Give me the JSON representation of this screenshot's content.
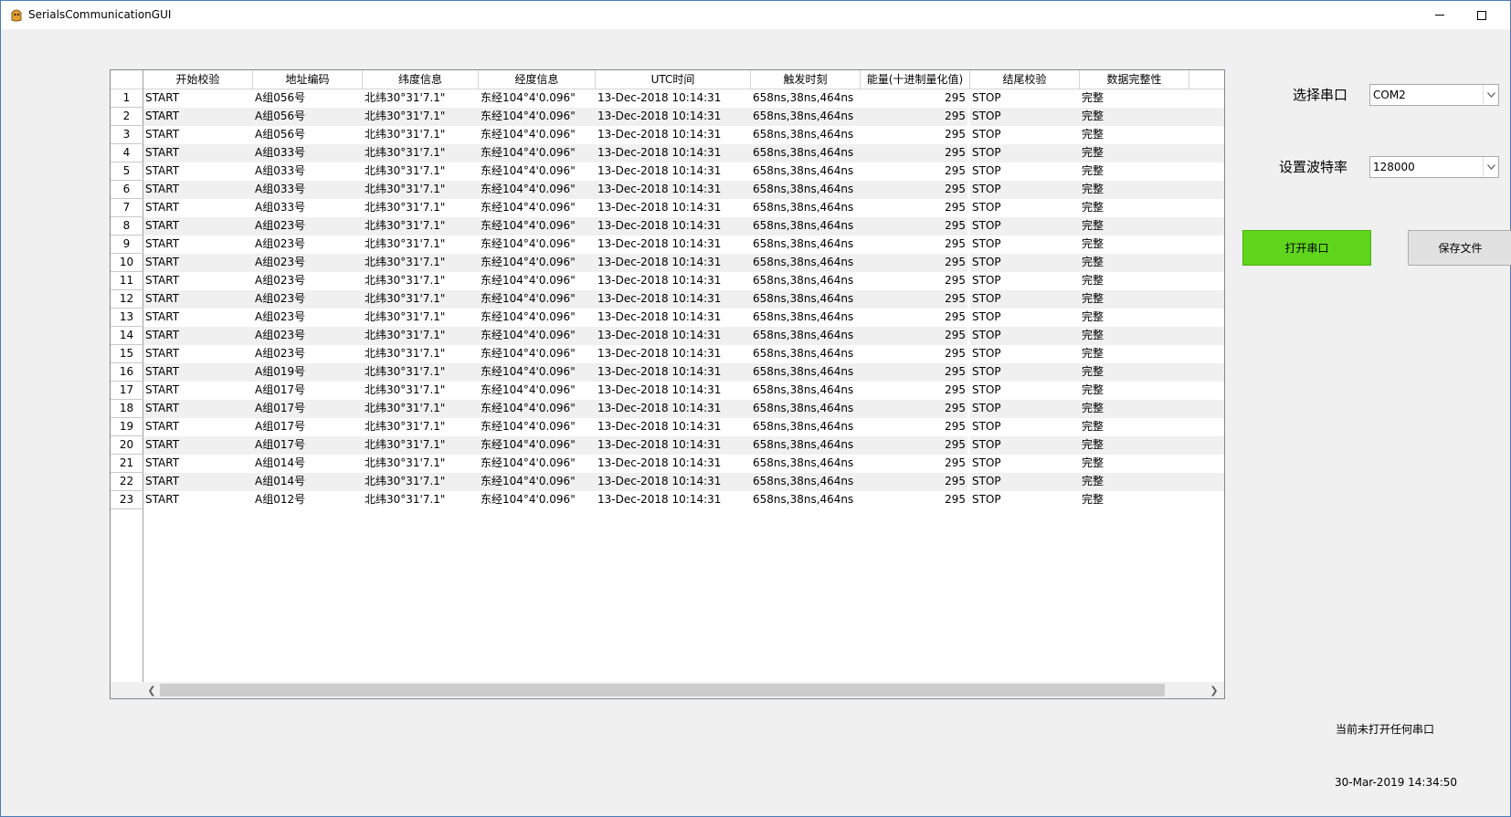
{
  "window": {
    "title": "SerialsCommunicationGUI"
  },
  "table": {
    "columns": [
      "开始校验",
      "地址编码",
      "纬度信息",
      "经度信息",
      "UTC时间",
      "触发时刻",
      "能量(十进制量化值)",
      "结尾校验",
      "数据完整性"
    ],
    "rows": [
      {
        "n": "1",
        "start": "START",
        "addr": "A组056号",
        "lat": "北纬30°31'7.1\"",
        "lon": "东经104°4'0.096\"",
        "utc": "13-Dec-2018 10:14:31",
        "trig": "658ns,38ns,464ns",
        "energy": "295",
        "end": "STOP",
        "integrity": "完整"
      },
      {
        "n": "2",
        "start": "START",
        "addr": "A组056号",
        "lat": "北纬30°31'7.1\"",
        "lon": "东经104°4'0.096\"",
        "utc": "13-Dec-2018 10:14:31",
        "trig": "658ns,38ns,464ns",
        "energy": "295",
        "end": "STOP",
        "integrity": "完整"
      },
      {
        "n": "3",
        "start": "START",
        "addr": "A组056号",
        "lat": "北纬30°31'7.1\"",
        "lon": "东经104°4'0.096\"",
        "utc": "13-Dec-2018 10:14:31",
        "trig": "658ns,38ns,464ns",
        "energy": "295",
        "end": "STOP",
        "integrity": "完整"
      },
      {
        "n": "4",
        "start": "START",
        "addr": "A组033号",
        "lat": "北纬30°31'7.1\"",
        "lon": "东经104°4'0.096\"",
        "utc": "13-Dec-2018 10:14:31",
        "trig": "658ns,38ns,464ns",
        "energy": "295",
        "end": "STOP",
        "integrity": "完整"
      },
      {
        "n": "5",
        "start": "START",
        "addr": "A组033号",
        "lat": "北纬30°31'7.1\"",
        "lon": "东经104°4'0.096\"",
        "utc": "13-Dec-2018 10:14:31",
        "trig": "658ns,38ns,464ns",
        "energy": "295",
        "end": "STOP",
        "integrity": "完整"
      },
      {
        "n": "6",
        "start": "START",
        "addr": "A组033号",
        "lat": "北纬30°31'7.1\"",
        "lon": "东经104°4'0.096\"",
        "utc": "13-Dec-2018 10:14:31",
        "trig": "658ns,38ns,464ns",
        "energy": "295",
        "end": "STOP",
        "integrity": "完整"
      },
      {
        "n": "7",
        "start": "START",
        "addr": "A组033号",
        "lat": "北纬30°31'7.1\"",
        "lon": "东经104°4'0.096\"",
        "utc": "13-Dec-2018 10:14:31",
        "trig": "658ns,38ns,464ns",
        "energy": "295",
        "end": "STOP",
        "integrity": "完整"
      },
      {
        "n": "8",
        "start": "START",
        "addr": "A组023号",
        "lat": "北纬30°31'7.1\"",
        "lon": "东经104°4'0.096\"",
        "utc": "13-Dec-2018 10:14:31",
        "trig": "658ns,38ns,464ns",
        "energy": "295",
        "end": "STOP",
        "integrity": "完整"
      },
      {
        "n": "9",
        "start": "START",
        "addr": "A组023号",
        "lat": "北纬30°31'7.1\"",
        "lon": "东经104°4'0.096\"",
        "utc": "13-Dec-2018 10:14:31",
        "trig": "658ns,38ns,464ns",
        "energy": "295",
        "end": "STOP",
        "integrity": "完整"
      },
      {
        "n": "10",
        "start": "START",
        "addr": "A组023号",
        "lat": "北纬30°31'7.1\"",
        "lon": "东经104°4'0.096\"",
        "utc": "13-Dec-2018 10:14:31",
        "trig": "658ns,38ns,464ns",
        "energy": "295",
        "end": "STOP",
        "integrity": "完整"
      },
      {
        "n": "11",
        "start": "START",
        "addr": "A组023号",
        "lat": "北纬30°31'7.1\"",
        "lon": "东经104°4'0.096\"",
        "utc": "13-Dec-2018 10:14:31",
        "trig": "658ns,38ns,464ns",
        "energy": "295",
        "end": "STOP",
        "integrity": "完整"
      },
      {
        "n": "12",
        "start": "START",
        "addr": "A组023号",
        "lat": "北纬30°31'7.1\"",
        "lon": "东经104°4'0.096\"",
        "utc": "13-Dec-2018 10:14:31",
        "trig": "658ns,38ns,464ns",
        "energy": "295",
        "end": "STOP",
        "integrity": "完整"
      },
      {
        "n": "13",
        "start": "START",
        "addr": "A组023号",
        "lat": "北纬30°31'7.1\"",
        "lon": "东经104°4'0.096\"",
        "utc": "13-Dec-2018 10:14:31",
        "trig": "658ns,38ns,464ns",
        "energy": "295",
        "end": "STOP",
        "integrity": "完整"
      },
      {
        "n": "14",
        "start": "START",
        "addr": "A组023号",
        "lat": "北纬30°31'7.1\"",
        "lon": "东经104°4'0.096\"",
        "utc": "13-Dec-2018 10:14:31",
        "trig": "658ns,38ns,464ns",
        "energy": "295",
        "end": "STOP",
        "integrity": "完整"
      },
      {
        "n": "15",
        "start": "START",
        "addr": "A组023号",
        "lat": "北纬30°31'7.1\"",
        "lon": "东经104°4'0.096\"",
        "utc": "13-Dec-2018 10:14:31",
        "trig": "658ns,38ns,464ns",
        "energy": "295",
        "end": "STOP",
        "integrity": "完整"
      },
      {
        "n": "16",
        "start": "START",
        "addr": "A组019号",
        "lat": "北纬30°31'7.1\"",
        "lon": "东经104°4'0.096\"",
        "utc": "13-Dec-2018 10:14:31",
        "trig": "658ns,38ns,464ns",
        "energy": "295",
        "end": "STOP",
        "integrity": "完整"
      },
      {
        "n": "17",
        "start": "START",
        "addr": "A组017号",
        "lat": "北纬30°31'7.1\"",
        "lon": "东经104°4'0.096\"",
        "utc": "13-Dec-2018 10:14:31",
        "trig": "658ns,38ns,464ns",
        "energy": "295",
        "end": "STOP",
        "integrity": "完整"
      },
      {
        "n": "18",
        "start": "START",
        "addr": "A组017号",
        "lat": "北纬30°31'7.1\"",
        "lon": "东经104°4'0.096\"",
        "utc": "13-Dec-2018 10:14:31",
        "trig": "658ns,38ns,464ns",
        "energy": "295",
        "end": "STOP",
        "integrity": "完整"
      },
      {
        "n": "19",
        "start": "START",
        "addr": "A组017号",
        "lat": "北纬30°31'7.1\"",
        "lon": "东经104°4'0.096\"",
        "utc": "13-Dec-2018 10:14:31",
        "trig": "658ns,38ns,464ns",
        "energy": "295",
        "end": "STOP",
        "integrity": "完整"
      },
      {
        "n": "20",
        "start": "START",
        "addr": "A组017号",
        "lat": "北纬30°31'7.1\"",
        "lon": "东经104°4'0.096\"",
        "utc": "13-Dec-2018 10:14:31",
        "trig": "658ns,38ns,464ns",
        "energy": "295",
        "end": "STOP",
        "integrity": "完整"
      },
      {
        "n": "21",
        "start": "START",
        "addr": "A组014号",
        "lat": "北纬30°31'7.1\"",
        "lon": "东经104°4'0.096\"",
        "utc": "13-Dec-2018 10:14:31",
        "trig": "658ns,38ns,464ns",
        "energy": "295",
        "end": "STOP",
        "integrity": "完整"
      },
      {
        "n": "22",
        "start": "START",
        "addr": "A组014号",
        "lat": "北纬30°31'7.1\"",
        "lon": "东经104°4'0.096\"",
        "utc": "13-Dec-2018 10:14:31",
        "trig": "658ns,38ns,464ns",
        "energy": "295",
        "end": "STOP",
        "integrity": "完整"
      },
      {
        "n": "23",
        "start": "START",
        "addr": "A组012号",
        "lat": "北纬30°31'7.1\"",
        "lon": "东经104°4'0.096\"",
        "utc": "13-Dec-2018 10:14:31",
        "trig": "658ns,38ns,464ns",
        "energy": "295",
        "end": "STOP",
        "integrity": "完整"
      }
    ],
    "scroll_left_icon": "chevron-left-icon",
    "scroll_right_icon": "chevron-right-icon"
  },
  "controls": {
    "port_label": "选择串口",
    "port_value": "COM2",
    "baud_label": "设置波特率",
    "baud_value": "128000",
    "open_button": "打开串口",
    "save_button": "保存文件",
    "open_button_color": "#5fd51c"
  },
  "status": {
    "message": "当前未打开任何串口",
    "datetime": "30-Mar-2019 14:34:50"
  }
}
